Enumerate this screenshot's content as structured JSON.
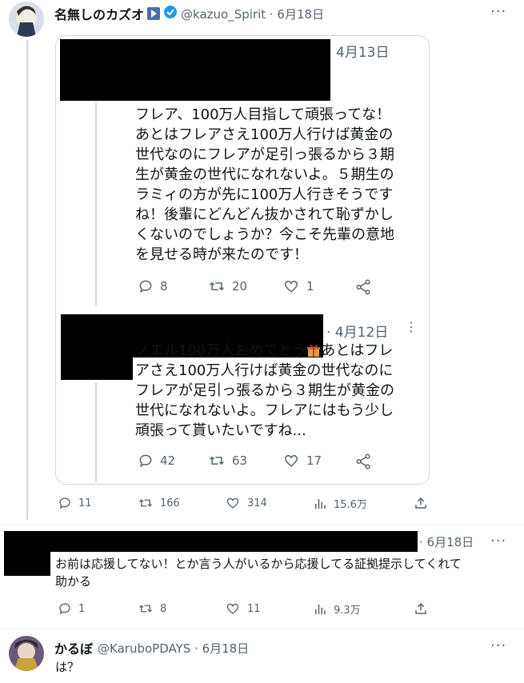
{
  "tweet1": {
    "name": "名無しのカズオ",
    "handle": "@kazuo_Spirit · 6月18日",
    "quote_a": {
      "date": "4月13日",
      "text_lines": [
        "フレア、100万人目指して頑張ってな！",
        "あとはフレアさえ100万人行けば黄金の",
        "世代なのにフレアが足引っ張るから３期",
        "生が黄金の世代になれないよ。５期生の",
        "ラミィの方が先に100万人行きそうです",
        "ね！後輩にどんどん抜かされて恥ずかし",
        "くないのでしょうか？今こそ先輩の意地",
        "を見せる時が来たのです！"
      ],
      "replies": "8",
      "retweets": "20",
      "likes": "1"
    },
    "quote_b": {
      "date": "· 4月12日",
      "line1": "ノエル100万人おめでとう",
      "line1_after": "あとはフレ",
      "text_lines": [
        "アさえ100万人行けば黄金の世代なのに",
        "フレアが足引っ張るから３期生が黄金の",
        "世代になれないよ。フレアにはもう少し",
        "頑張って貰いたいですね..."
      ],
      "replies": "42",
      "retweets": "63",
      "likes": "17"
    },
    "replies": "11",
    "retweets": "166",
    "likes": "314",
    "views": "15.6万"
  },
  "tweet2": {
    "date": "· 6月18日",
    "text_lines": [
      "お前は応援してない！とか言う人がいるから応援してる証拠提示してくれて",
      "助かる"
    ],
    "replies": "1",
    "retweets": "8",
    "likes": "11",
    "views": "9.3万"
  },
  "tweet3": {
    "name": "かるぼ",
    "handle": "@KaruboPDAYS · 6月18日",
    "text": "は？"
  },
  "more": "···",
  "colors": {
    "verified": "#1d9bf0",
    "play_badge": "#4a6fa5",
    "muted": "#536471",
    "border": "#cfd9de"
  }
}
